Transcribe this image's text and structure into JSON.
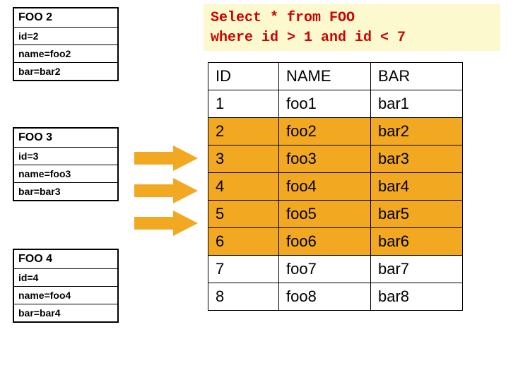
{
  "sql": {
    "line1": "Select * from FOO",
    "line2": "where id > 1 and id < 7"
  },
  "records": [
    {
      "title": "FOO 2",
      "rows": [
        "id=2",
        "name=foo2",
        "bar=bar2"
      ]
    },
    {
      "title": "FOO 3",
      "rows": [
        "id=3",
        "name=foo3",
        "bar=bar3"
      ]
    },
    {
      "title": "FOO 4",
      "rows": [
        "id=4",
        "name=foo4",
        "bar=bar4"
      ]
    }
  ],
  "table": {
    "headers": [
      "ID",
      "NAME",
      "BAR"
    ],
    "rows": [
      {
        "cells": [
          "1",
          "foo1",
          "bar1"
        ],
        "highlight": false
      },
      {
        "cells": [
          "2",
          "foo2",
          "bar2"
        ],
        "highlight": true
      },
      {
        "cells": [
          "3",
          "foo3",
          "bar3"
        ],
        "highlight": true
      },
      {
        "cells": [
          "4",
          "foo4",
          "bar4"
        ],
        "highlight": true
      },
      {
        "cells": [
          "5",
          "foo5",
          "bar5"
        ],
        "highlight": true
      },
      {
        "cells": [
          "6",
          "foo6",
          "bar6"
        ],
        "highlight": true
      },
      {
        "cells": [
          "7",
          "foo7",
          "bar7"
        ],
        "highlight": false
      },
      {
        "cells": [
          "8",
          "foo8",
          "bar8"
        ],
        "highlight": false
      }
    ]
  },
  "arrow_color": "#f2a921"
}
